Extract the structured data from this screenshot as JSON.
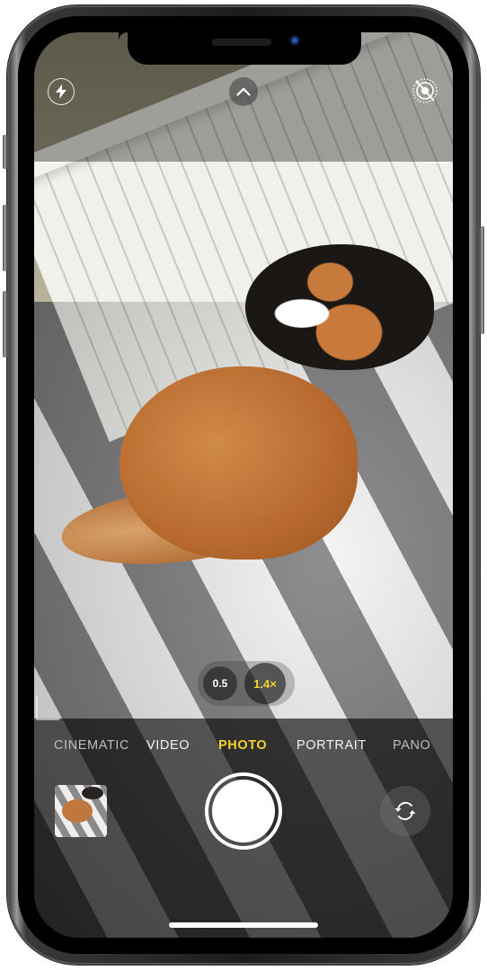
{
  "device": "iPhone",
  "app": "Camera",
  "top_controls": {
    "flash_icon": "flash-bolt-icon",
    "expand_icon": "chevron-up-icon",
    "live_photo_icon": "live-photo-off-icon"
  },
  "zoom": {
    "options": [
      {
        "label": "0.5",
        "selected": false
      },
      {
        "label": "1.4×",
        "selected": true
      }
    ]
  },
  "modes": [
    {
      "label": "CINEMATIC",
      "active": false
    },
    {
      "label": "VIDEO",
      "active": false
    },
    {
      "label": "PHOTO",
      "active": true
    },
    {
      "label": "PORTRAIT",
      "active": false
    },
    {
      "label": "PANO",
      "active": false
    }
  ],
  "bottom_controls": {
    "last_photo_thumbnail": "photo-thumbnail",
    "shutter": "shutter-button",
    "flip_icon": "camera-flip-icon"
  },
  "colors": {
    "accent_yellow": "#f5d130",
    "text_white": "#f2f2f2"
  },
  "viewfinder_description": "Two cats sleeping on a gray and white striped comforter against a white paneled headboard"
}
